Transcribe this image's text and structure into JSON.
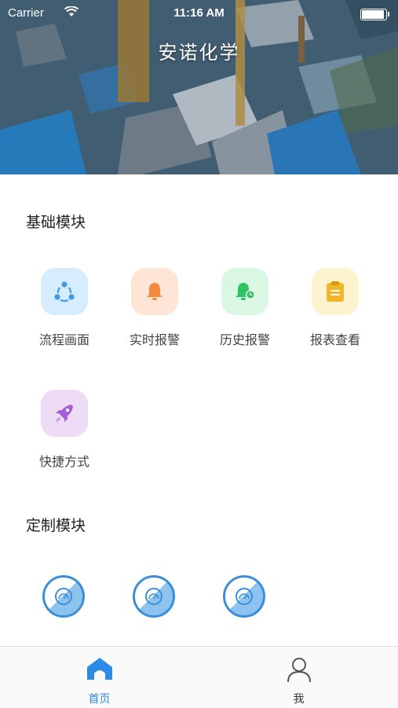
{
  "status_bar": {
    "carrier": "Carrier",
    "time": "11:16 AM",
    "battery_level": 1.0
  },
  "header": {
    "title": "安诺化学"
  },
  "basic_section": {
    "title": "基础模块",
    "modules": [
      {
        "label": "流程画面",
        "icon": "share-network-icon",
        "bg": "#d6ecff",
        "fg": "#3d9be9"
      },
      {
        "label": "实时报警",
        "icon": "bell-icon",
        "bg": "#ffe5d6",
        "fg": "#f58a3c"
      },
      {
        "label": "历史报警",
        "icon": "bell-clock-icon",
        "bg": "#d9f7e2",
        "fg": "#2fc463"
      },
      {
        "label": "报表查看",
        "icon": "clipboard-icon",
        "bg": "#fdf4cf",
        "fg": "#f0b72a"
      },
      {
        "label": "快捷方式",
        "icon": "rocket-icon",
        "bg": "#eedcf7",
        "fg": "#a65cd6"
      }
    ]
  },
  "custom_section": {
    "title": "定制模块",
    "items": [
      {
        "icon": "gauge-icon"
      },
      {
        "icon": "gauge-icon"
      },
      {
        "icon": "gauge-icon"
      }
    ]
  },
  "tab_bar": {
    "tabs": [
      {
        "label": "首页",
        "icon": "home-icon",
        "active": true
      },
      {
        "label": "我",
        "icon": "user-icon",
        "active": false
      }
    ],
    "active_color": "#2b8be6",
    "inactive_color": "#333333"
  }
}
